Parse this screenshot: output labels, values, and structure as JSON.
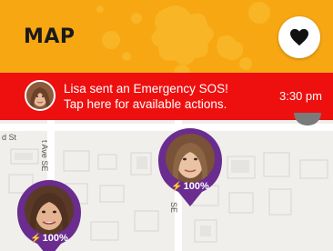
{
  "header": {
    "title": "MAP",
    "heart_icon": "heart-icon"
  },
  "sos_banner": {
    "message_line1": "Lisa sent an Emergency SOS!",
    "message_line2": "Tap here for available actions.",
    "time": "3:30 pm",
    "avatar_icon": "avatar"
  },
  "map": {
    "streets": {
      "horizontal": "d St",
      "vertical_1": "t Ave SE",
      "vertical_2": "SE"
    }
  },
  "markers": [
    {
      "battery_label": "100%",
      "icon": "bolt-icon"
    },
    {
      "battery_label": "100%",
      "icon": "bolt-icon"
    }
  ],
  "colors": {
    "header_orange": "#f6a712",
    "sos_red": "#ee0f0f",
    "marker_purple": "#6a2c8e",
    "map_background": "#f0efec"
  }
}
